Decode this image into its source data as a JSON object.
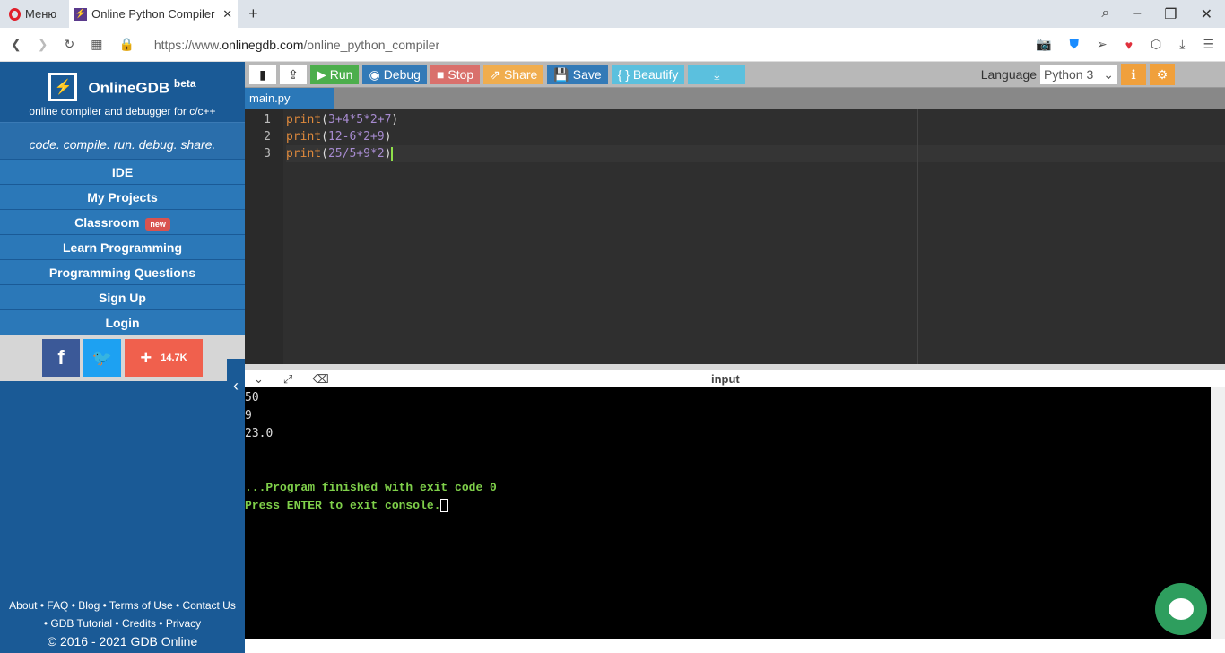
{
  "browser": {
    "menu_label": "Меню",
    "tab_title": "Online Python Compiler - online",
    "url_prefix": "https://www.",
    "url_domain": "onlinegdb.com",
    "url_path": "/online_python_compiler"
  },
  "sidebar": {
    "brand": "OnlineGDB",
    "beta": "beta",
    "subtitle": "online compiler and debugger for c/c++",
    "tagline": "code. compile. run. debug. share.",
    "nav": [
      "IDE",
      "My Projects",
      "Classroom",
      "Learn Programming",
      "Programming Questions",
      "Sign Up",
      "Login"
    ],
    "new_badge": "new",
    "share_count": "14.7K",
    "footer_line1": "About • FAQ • Blog • Terms of Use • Contact Us",
    "footer_line2": "• GDB Tutorial • Credits • Privacy",
    "copyright": "© 2016 - 2021 GDB Online"
  },
  "toolbar": {
    "run": "Run",
    "debug": "Debug",
    "stop": "Stop",
    "share": "Share",
    "save": "Save",
    "beautify": "{ } Beautify",
    "language_label": "Language",
    "language_value": "Python 3"
  },
  "editor": {
    "file_tab": "main.py",
    "lines": [
      "print(3+4*5*2+7)",
      "print(12-6*2+9)",
      "print(25/5+9*2)"
    ],
    "line_numbers": [
      "1",
      "2",
      "3"
    ]
  },
  "console": {
    "title": "input",
    "output": [
      "50",
      "9",
      "23.0"
    ],
    "finished": "...Program finished with exit code 0",
    "press": "Press ENTER to exit console."
  }
}
